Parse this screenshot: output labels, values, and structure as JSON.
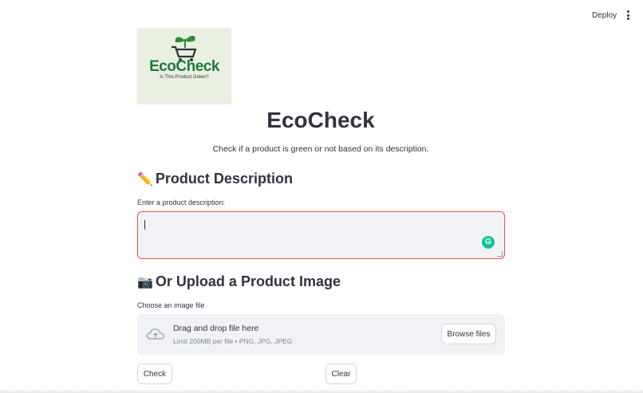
{
  "header": {
    "deploy_label": "Deploy",
    "menu_icon": "vertical-ellipsis-icon"
  },
  "logo": {
    "title": "EcoCheck",
    "tagline": "Is This Product Green?",
    "icon": "shopping-cart-sprout-icon"
  },
  "page": {
    "title": "EcoCheck",
    "subtitle": "Check if a product is green or not based on its description."
  },
  "description_section": {
    "emoji": "✏️",
    "heading": "Product Description",
    "input_label": "Enter a product description:",
    "input_value": "",
    "assist_icon": "grammarly-icon"
  },
  "upload_section": {
    "emoji": "📷",
    "heading": "Or Upload a Product Image",
    "label": "Choose an image file",
    "drop_text": "Drag and drop file here",
    "limit_text": "Limit 200MB per file • PNG, JPG, JPEG",
    "browse_label": "Browse files",
    "upload_icon": "cloud-upload-icon"
  },
  "actions": {
    "check_label": "Check",
    "clear_label": "Clear"
  },
  "colors": {
    "accent_error": "#ff4b4b",
    "input_bg": "#f0f2f6",
    "text": "#31333f",
    "logo_green": "#1e7a3c"
  }
}
